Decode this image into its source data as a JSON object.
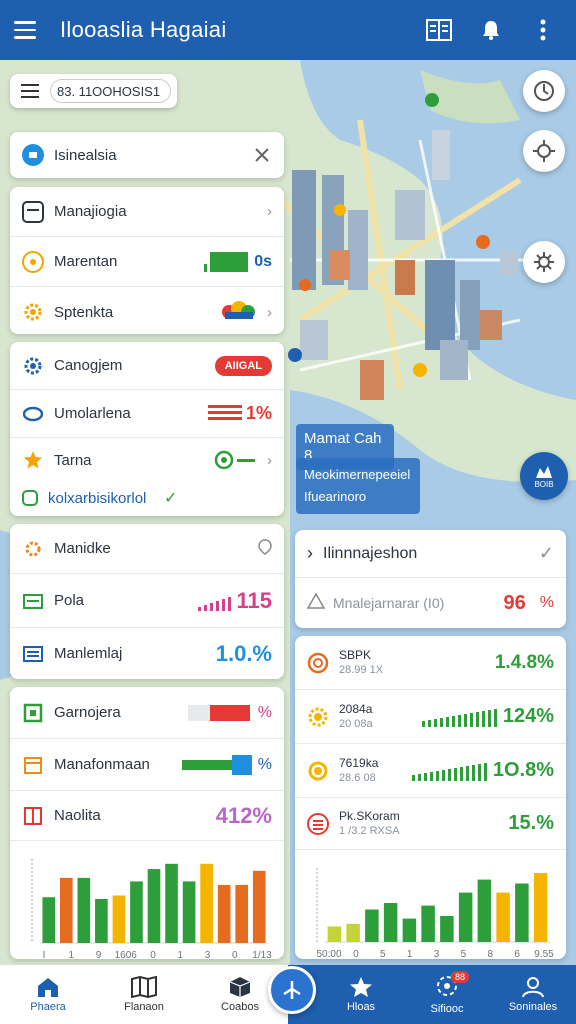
{
  "app": {
    "title": "Ilooaslia Hagaiai"
  },
  "search": {
    "value": "83. 11OOHOSIS1"
  },
  "left_cards": {
    "card1": {
      "label": "Isinealsia"
    },
    "card2": [
      {
        "label": "Manajiogia",
        "icon": "window-icon",
        "color": "#2b3440"
      },
      {
        "label": "Marentan",
        "icon": "globe-icon",
        "color": "#f4a300",
        "value": "0s"
      },
      {
        "label": "Sptenkta",
        "icon": "gear-icon",
        "color": "#f4a300"
      }
    ],
    "card3": [
      {
        "label": "Canogjem",
        "icon": "gear-icon",
        "color": "#1f5fb0",
        "badge": "AIIGAL"
      },
      {
        "label": "Umolarlena",
        "icon": "chat-icon",
        "color": "#1f5fb0",
        "value": "1%"
      },
      {
        "label": "Tarna",
        "icon": "star-icon",
        "color": "#f4a300"
      },
      {
        "label": "kolxarbisikorlol",
        "icon": "square-icon",
        "color": "#2e9e3a"
      }
    ],
    "card4": [
      {
        "label": "Manidke",
        "icon": "sun-icon",
        "color": "#f08a1c"
      },
      {
        "label": "Pola",
        "icon": "doc-icon",
        "color": "#2e9e3a",
        "value": "115"
      },
      {
        "label": "Manlemlaj",
        "icon": "list-icon",
        "color": "#1f5fb0",
        "value": "1.0.%"
      }
    ],
    "card5": [
      {
        "label": "Garnojera",
        "icon": "square-icon",
        "color": "#2e9e3a",
        "value": "%"
      },
      {
        "label": "Manafonmaan",
        "icon": "calendar-icon",
        "color": "#f08a1c",
        "value": "%"
      },
      {
        "label": "Naolita",
        "icon": "grid-icon",
        "color": "#e53935",
        "value": "412%"
      }
    ]
  },
  "map_overlay": {
    "title": "Mamat Cah 8",
    "line1": "Meokimernepeeiel",
    "line2": "Ifuearinoro",
    "fab_label": "BOIB"
  },
  "right_cards": {
    "header": {
      "label": "Ilinnnajeshon"
    },
    "sub": {
      "label": "Mnalejarnarar (I0)",
      "value": "96",
      "unit": "%"
    },
    "rows": [
      {
        "label": "SBPK",
        "sub": "28.99 1X",
        "value": "1.4.8%",
        "color": "#e56b1f"
      },
      {
        "label": "2084a",
        "sub": "20 08a",
        "value": "124%",
        "color": "#f4b400"
      },
      {
        "label": "7619ka",
        "sub": "28.6 08",
        "value": "1O.8%",
        "color": "#f4b400"
      },
      {
        "label": "Pk.SKoram",
        "sub": "1 /3.2 RXSA",
        "value": "15.%",
        "color": "#e53935"
      }
    ]
  },
  "chart_left": {
    "ticks": [
      "I",
      "1",
      "9",
      "1606",
      "0",
      "1",
      "3",
      "0",
      "1/13"
    ]
  },
  "chart_right": {
    "ticks": [
      "50:00",
      "0",
      "5",
      "1",
      "3",
      "5",
      "8",
      "6",
      "9.55"
    ]
  },
  "chart_data": [
    {
      "type": "bar",
      "values": [
        26,
        37,
        37,
        25,
        27,
        35,
        42,
        45,
        35,
        45,
        33,
        33,
        41
      ],
      "colors": [
        "#2e9e3a",
        "#e56b1f",
        "#2e9e3a",
        "#2e9e3a",
        "#f4b400",
        "#2e9e3a",
        "#2e9e3a",
        "#2e9e3a",
        "#2e9e3a",
        "#f4b400",
        "#e56b1f",
        "#e56b1f",
        "#e56b1f"
      ],
      "ylim": [
        0,
        50
      ]
    },
    {
      "type": "bar",
      "values": [
        12,
        14,
        25,
        30,
        18,
        28,
        20,
        38,
        48,
        38,
        45,
        53
      ],
      "colors": [
        "#c2d43a",
        "#c2d43a",
        "#2e9e3a",
        "#2e9e3a",
        "#2e9e3a",
        "#2e9e3a",
        "#2e9e3a",
        "#2e9e3a",
        "#2e9e3a",
        "#f4b400",
        "#2e9e3a",
        "#f4b400"
      ],
      "ylim": [
        0,
        60
      ]
    }
  ],
  "nav": {
    "items": [
      {
        "label": "Phaera",
        "icon": "home-icon"
      },
      {
        "label": "Flanaon",
        "icon": "map-icon"
      },
      {
        "label": "Coabos",
        "icon": "box-icon"
      },
      {
        "label": "Hloas",
        "icon": "star-icon"
      },
      {
        "label": "Sifiooc",
        "icon": "location-icon",
        "badge": "88"
      },
      {
        "label": "Soninales",
        "icon": "user-icon"
      }
    ]
  }
}
